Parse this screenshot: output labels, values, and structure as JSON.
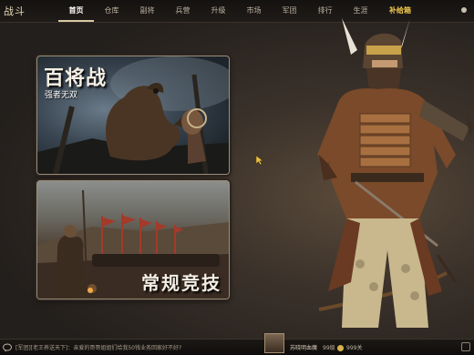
{
  "app": {
    "logo_text": "战斗"
  },
  "nav": {
    "items": [
      {
        "label": "首页",
        "active": true
      },
      {
        "label": "仓库"
      },
      {
        "label": "副将"
      },
      {
        "label": "兵营"
      },
      {
        "label": "升级"
      },
      {
        "label": "市场"
      },
      {
        "label": "军团"
      },
      {
        "label": "排行"
      },
      {
        "label": "生涯"
      },
      {
        "label": "补给箱",
        "highlight": true
      }
    ]
  },
  "cards": {
    "hundred_generals": {
      "title": "百将战",
      "subtitle": "强者无双"
    },
    "regular_competition": {
      "title": "常规竞技"
    }
  },
  "bottom": {
    "chat_text": "[军团][老王养送天下]：亲爱的哥哥姐姐们给我50钱业务回家好不好?",
    "player_name": "苏晓明血魔",
    "player_level": "99级",
    "gold": "999关"
  },
  "colors": {
    "accent": "#f2c94c",
    "text": "#e9dcc3"
  }
}
